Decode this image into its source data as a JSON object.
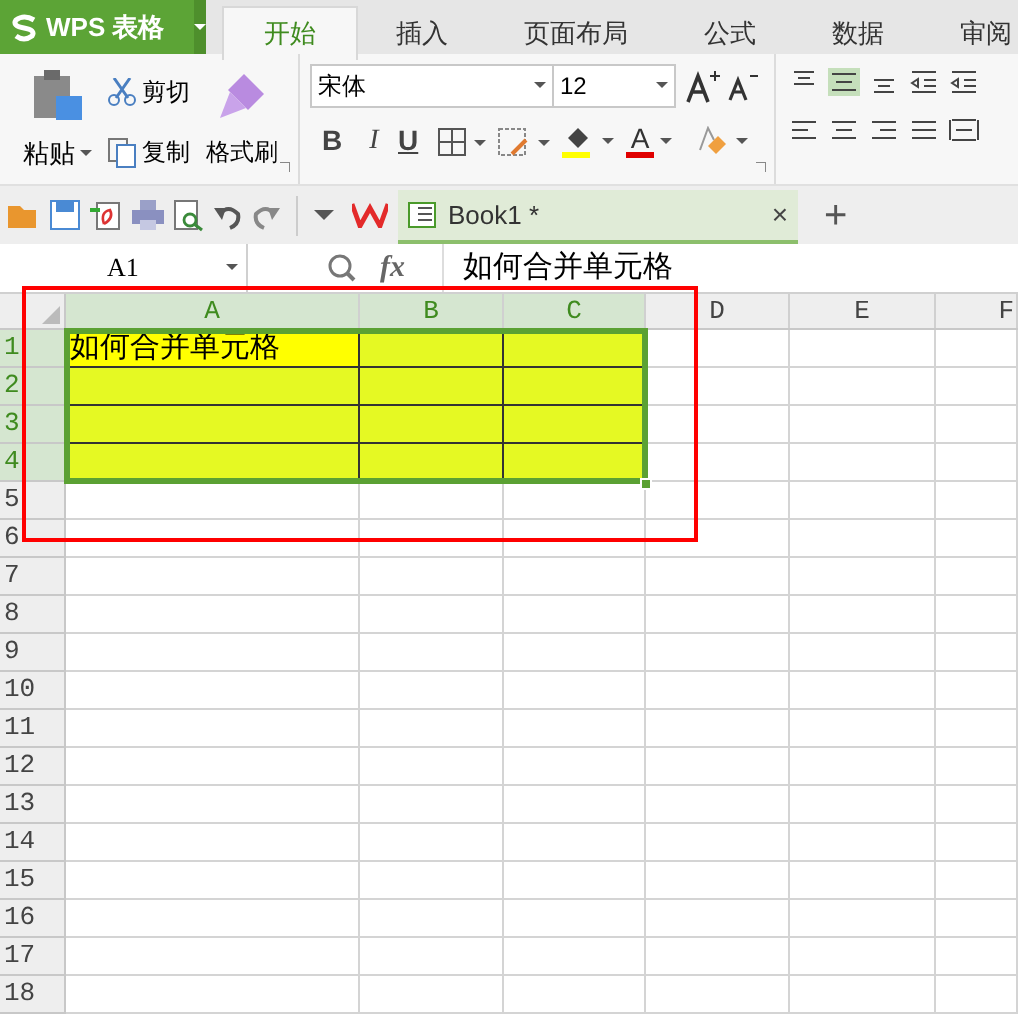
{
  "app_menu": {
    "label": "WPS 表格"
  },
  "tabs": [
    {
      "label": "开始",
      "selected": true
    },
    {
      "label": "插入",
      "selected": false
    },
    {
      "label": "页面布局",
      "selected": false
    },
    {
      "label": "公式",
      "selected": false
    },
    {
      "label": "数据",
      "selected": false
    },
    {
      "label": "审阅",
      "selected": false
    }
  ],
  "ribbon": {
    "paste": "粘贴",
    "cut": "剪切",
    "copy": "复制",
    "format_painter": "格式刷",
    "font": "宋体",
    "font_size": "12",
    "bold": "B",
    "italic": "I",
    "underline": "U",
    "font_color": "A"
  },
  "document_tab": {
    "title": "Book1 *",
    "close": "×",
    "new": "+"
  },
  "formula_bar": {
    "cell": "A1",
    "fx": "fx",
    "formula": "如何合并单元格"
  },
  "sheet": {
    "columns": [
      {
        "label": "A",
        "selected": true
      },
      {
        "label": "B",
        "selected": true
      },
      {
        "label": "C",
        "selected": true
      },
      {
        "label": "D",
        "selected": false
      },
      {
        "label": "E",
        "selected": false
      },
      {
        "label": "F",
        "selected": false
      }
    ],
    "rows": [
      {
        "label": "1",
        "selected": true,
        "cells": [
          {
            "text": "如何合并单元格",
            "color": "#ffff00"
          },
          {
            "color": "#e5f923"
          },
          {
            "color": "#e5f923"
          }
        ]
      },
      {
        "label": "2",
        "selected": true,
        "cells": [
          {
            "color": "#e5f923"
          },
          {
            "color": "#e5f923"
          },
          {
            "color": "#e5f923"
          }
        ]
      },
      {
        "label": "3",
        "selected": true,
        "cells": [
          {
            "color": "#e5f923"
          },
          {
            "color": "#e5f923"
          },
          {
            "color": "#e5f923"
          }
        ]
      },
      {
        "label": "4",
        "selected": true,
        "cells": [
          {
            "color": "#e5f923"
          },
          {
            "color": "#e5f923"
          },
          {
            "color": "#e5f923"
          }
        ]
      },
      {
        "label": "5",
        "selected": false
      },
      {
        "label": "6",
        "selected": false
      },
      {
        "label": "7",
        "selected": false
      },
      {
        "label": "8",
        "selected": false
      },
      {
        "label": "9",
        "selected": false
      },
      {
        "label": "10",
        "selected": false
      },
      {
        "label": "11",
        "selected": false
      },
      {
        "label": "12",
        "selected": false
      },
      {
        "label": "13",
        "selected": false
      },
      {
        "label": "14",
        "selected": false
      },
      {
        "label": "15",
        "selected": false
      },
      {
        "label": "16",
        "selected": false
      },
      {
        "label": "17",
        "selected": false
      },
      {
        "label": "18",
        "selected": false
      }
    ]
  }
}
